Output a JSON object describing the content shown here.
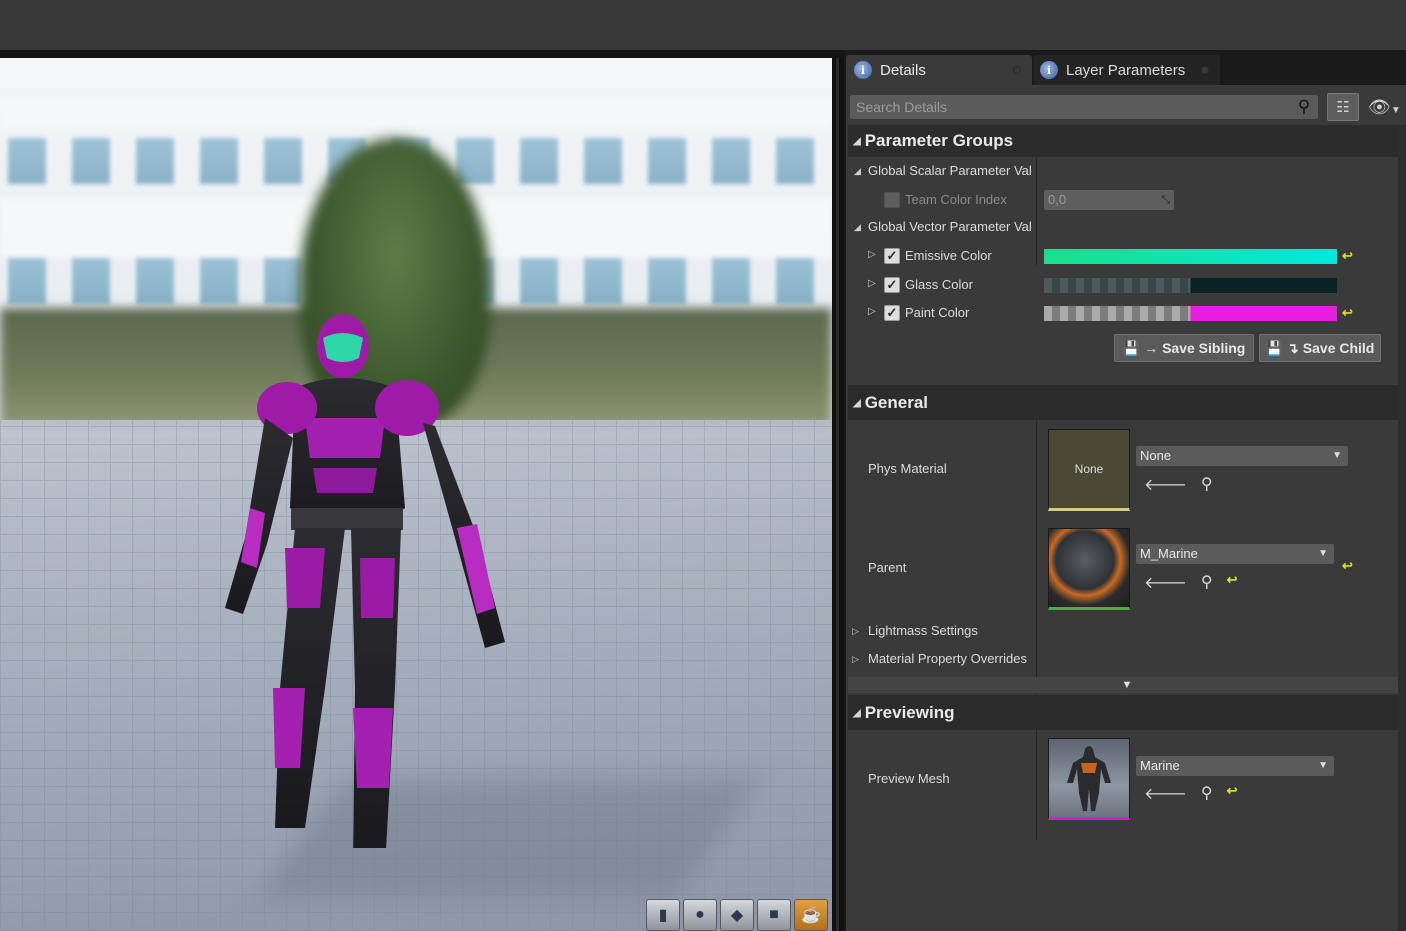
{
  "tabs": {
    "details": "Details",
    "layer_parameters": "Layer Parameters"
  },
  "search": {
    "placeholder": "Search Details"
  },
  "sections": {
    "parameter_groups": "Parameter Groups",
    "general": "General",
    "previewing": "Previewing"
  },
  "parameter_groups": {
    "scalar_group": "Global Scalar Parameter Val",
    "vector_group": "Global Vector Parameter Val",
    "team_color_index": {
      "label": "Team Color Index",
      "value": "0,0",
      "enabled": false
    },
    "emissive_color": {
      "label": "Emissive Color",
      "checked": true,
      "color": "#00e8c4"
    },
    "glass_color": {
      "label": "Glass Color",
      "checked": true,
      "color": "#0a2a2e"
    },
    "paint_color": {
      "label": "Paint Color",
      "checked": true,
      "color": "#e61ce0"
    },
    "save_sibling": "Save Sibling",
    "save_child": "Save Child"
  },
  "general": {
    "phys_material": {
      "label": "Phys Material",
      "thumb": "None",
      "value": "None"
    },
    "parent": {
      "label": "Parent",
      "value": "M_Marine"
    },
    "lightmass": "Lightmass Settings",
    "material_overrides": "Material Property Overrides"
  },
  "previewing": {
    "preview_mesh": {
      "label": "Preview Mesh",
      "value": "Marine"
    }
  },
  "icons": {
    "search": "magnifier-icon",
    "view_options": "eye-icon",
    "table": "table-icon"
  },
  "colors": {
    "accent_reset": "#dede2a",
    "panel_bg": "#3a3a3a"
  }
}
